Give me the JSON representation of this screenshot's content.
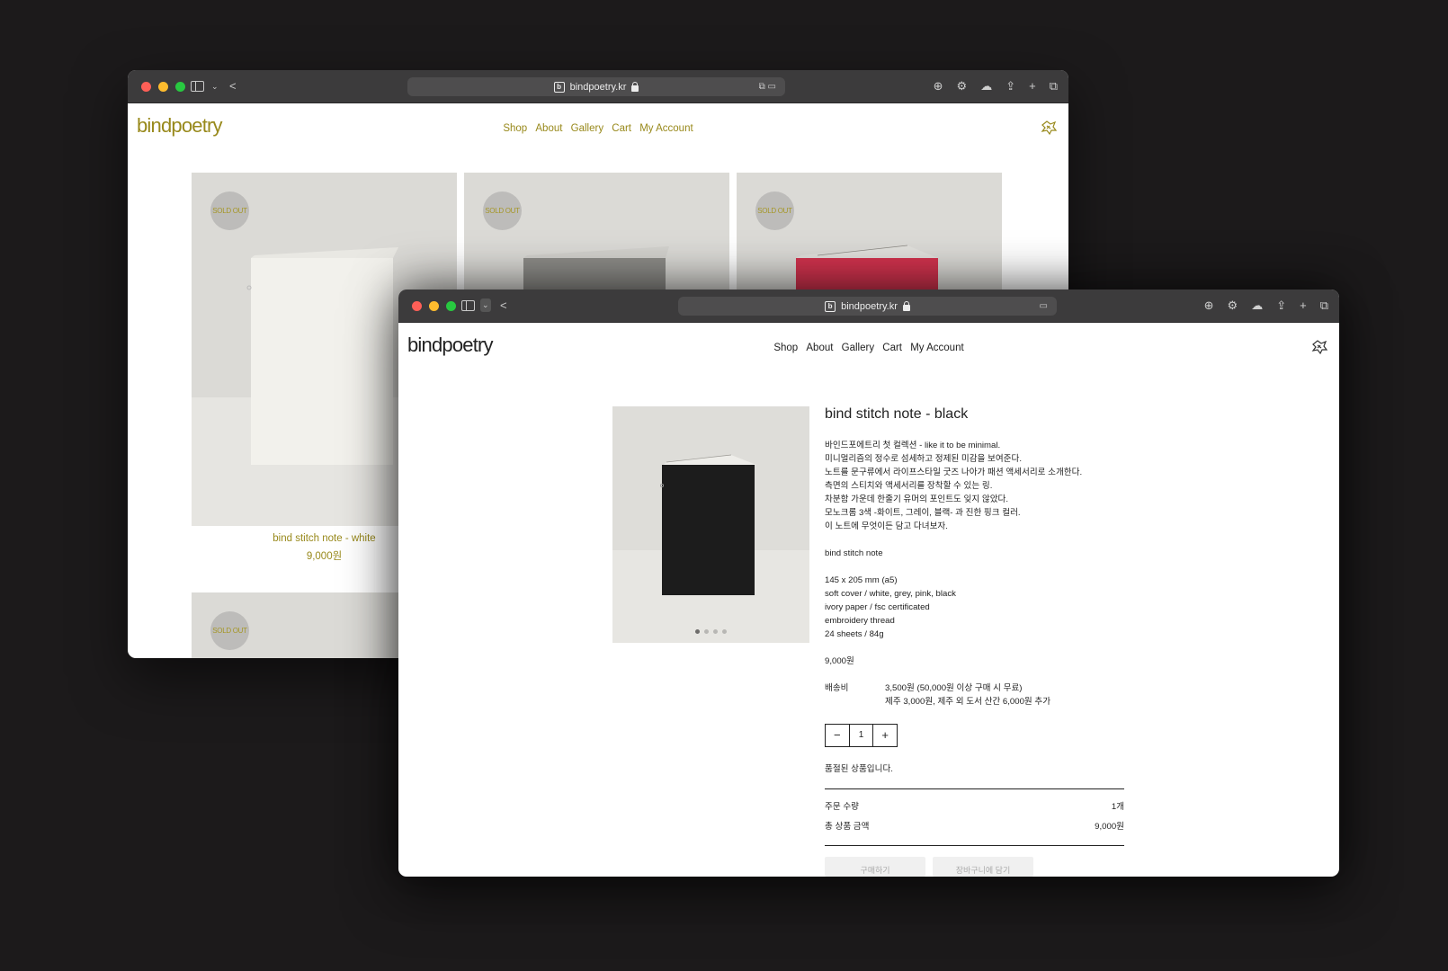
{
  "back_window": {
    "url": "bindpoetry.kr",
    "logo": "bindpoetry",
    "nav": [
      "Shop",
      "About",
      "Gallery",
      "Cart",
      "My Account"
    ],
    "colors": {
      "accent": "#98891b"
    },
    "products": [
      {
        "badge": "SOLD OUT",
        "name": "bind stitch note - white",
        "price": "9,000원"
      },
      {
        "badge": "SOLD OUT"
      },
      {
        "badge": "SOLD OUT"
      },
      {
        "badge": "SOLD OUT"
      }
    ]
  },
  "front_window": {
    "url": "bindpoetry.kr",
    "logo": "bindpoetry",
    "nav": [
      "Shop",
      "About",
      "Gallery",
      "Cart",
      "My Account"
    ],
    "product": {
      "title": "bind stitch note - black",
      "description": [
        "바인드포에트리 첫 컬렉션 - like it to be minimal.",
        "미니멀리즘의 정수로 섬세하고 정제된 미감을 보여준다.",
        "노트를 문구류에서 라이프스타일 굿즈 나아가 패션 액세서리로 소개한다.",
        "측면의 스티치와 액세서리를 장착할 수 있는 링.",
        "차분함 가운데 한줄기 유머의 포인트도 잊지 않았다.",
        "모노크롬 3색 -화이트, 그레이, 블랙- 과 진한 핑크 컬러.",
        "이 노트에 무엇이든 담고 다녀보자."
      ],
      "subtitle": "bind stitch note",
      "specs": [
        "145 x 205 mm (a5)",
        "soft cover / white, grey, pink, black",
        "ivory paper / fsc certificated",
        "embroidery thread",
        "24 sheets / 84g"
      ],
      "price": "9,000원",
      "shipping_label": "배송비",
      "shipping_lines": [
        "3,500원 (50,000원 이상 구매 시 무료)",
        "제주 3,000원, 제주 외 도서 산간 6,000원 추가"
      ],
      "quantity": "1",
      "minus": "−",
      "plus": "+",
      "soldout_msg": "품절된 상품입니다.",
      "order_qty_label": "주문 수량",
      "order_qty_value": "1개",
      "total_label": "총 상품 금액",
      "total_value": "9,000원",
      "buy_label": "구매하기",
      "cart_label": "장바구니에 담기",
      "image_dots": {
        "count": 4,
        "active": 1
      }
    }
  }
}
